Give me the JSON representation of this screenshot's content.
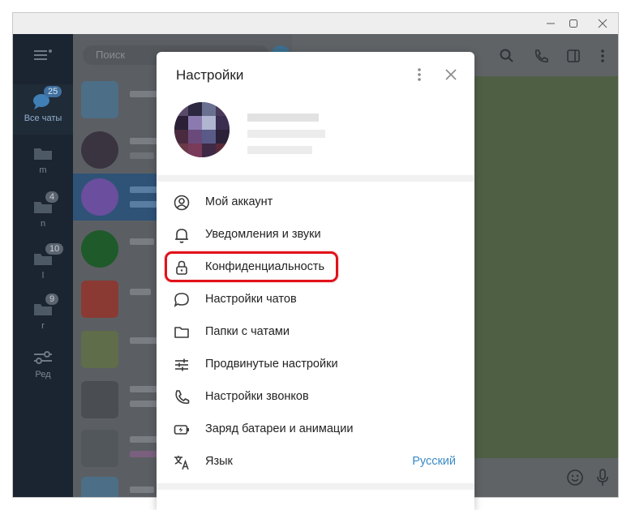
{
  "window": {
    "controls": [
      "minimize-icon",
      "maximize-icon",
      "close-icon"
    ]
  },
  "background": {
    "search_placeholder": "Поиск",
    "folders": [
      {
        "label": "Все чаты",
        "badge": "25",
        "icon": "chat-bubbles-icon"
      },
      {
        "label": "m",
        "badge": "",
        "icon": "folder-icon"
      },
      {
        "label": "n",
        "badge": "4",
        "icon": "folder-icon"
      },
      {
        "label": "l",
        "badge": "10",
        "icon": "folder-icon"
      },
      {
        "label": "r",
        "badge": "9",
        "icon": "folder-icon"
      },
      {
        "label": "Ред",
        "badge": "",
        "icon": "sliders-icon"
      }
    ]
  },
  "dialog": {
    "title": "Настройки",
    "items": [
      {
        "label": "Мой аккаунт",
        "icon": "account-icon"
      },
      {
        "label": "Уведомления и звуки",
        "icon": "bell-icon"
      },
      {
        "label": "Конфиденциальность",
        "icon": "lock-icon"
      },
      {
        "label": "Настройки чатов",
        "icon": "chat-bubble-icon"
      },
      {
        "label": "Папки с чатами",
        "icon": "folder-icon"
      },
      {
        "label": "Продвинутые настройки",
        "icon": "sliders-icon"
      },
      {
        "label": "Настройки звонков",
        "icon": "phone-icon"
      },
      {
        "label": "Заряд батареи и анимации",
        "icon": "battery-icon"
      },
      {
        "label": "Язык",
        "icon": "translate-icon",
        "value": "Русский"
      }
    ],
    "highlight_color": "#e0121a",
    "accent_color": "#3a8ac6"
  }
}
